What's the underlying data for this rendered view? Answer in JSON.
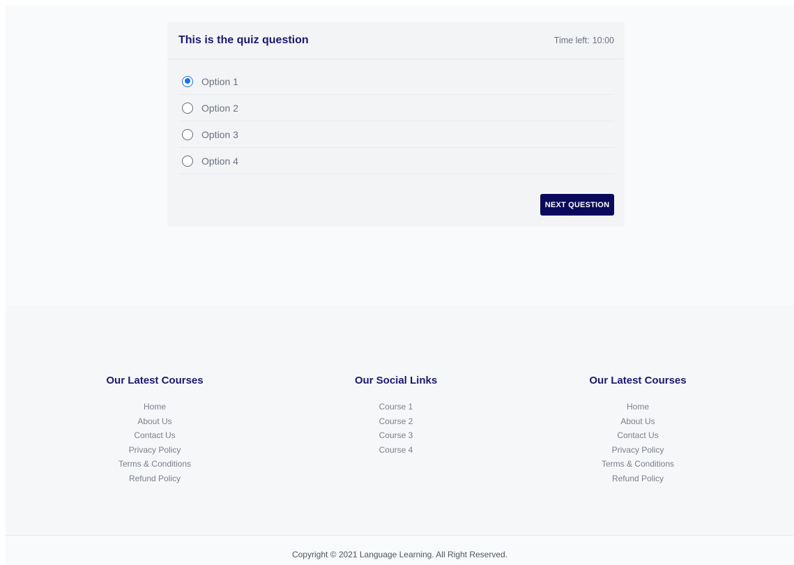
{
  "quiz": {
    "title": "This is the quiz question",
    "timer_label": "Time left:",
    "timer_value": "10:00",
    "options": [
      {
        "label": "Option 1",
        "selected": true
      },
      {
        "label": "Option 2",
        "selected": false
      },
      {
        "label": "Option 3",
        "selected": false
      },
      {
        "label": "Option 4",
        "selected": false
      }
    ],
    "next_button_label": "NEXT QUESTION"
  },
  "footer": {
    "columns": [
      {
        "heading": "Our Latest Courses",
        "links": [
          "Home",
          "About Us",
          "Contact Us",
          "Privacy Policy",
          "Terms & Conditions",
          "Refund Policy"
        ]
      },
      {
        "heading": "Our Social Links",
        "links": [
          "Course 1",
          "Course 2",
          "Course 3",
          "Course 4"
        ]
      },
      {
        "heading": "Our Latest Courses",
        "links": [
          "Home",
          "About Us",
          "Contact Us",
          "Privacy Policy",
          "Terms & Conditions",
          "Refund Policy"
        ]
      }
    ],
    "copyright": "Copyright © 2021 Language Learning. All Right Reserved."
  },
  "colors": {
    "brand_navy": "#0a0a5c",
    "heading_navy": "#1a1a6e",
    "radio_selected": "#1a73e8"
  }
}
